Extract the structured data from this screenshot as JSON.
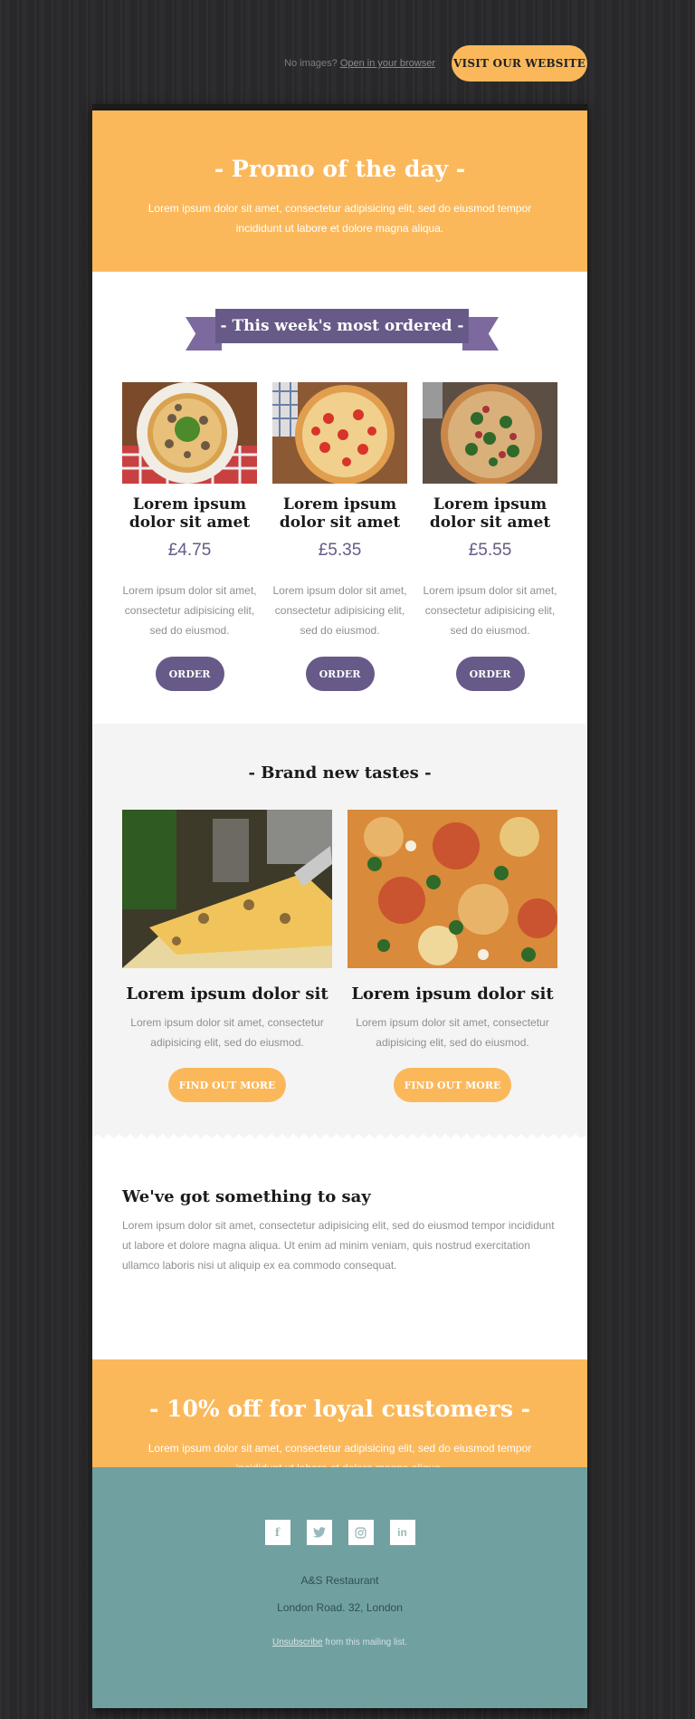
{
  "topbar": {
    "no_images_text": "No images?",
    "open_browser_link": "Open in your browser",
    "visit_button": "VISIT OUR WEBSITE"
  },
  "promo": {
    "title": "- Promo of the day -",
    "text": "Lorem ipsum dolor sit amet, consectetur adipisicing elit, sed do eiusmod tempor incididunt ut labore et dolore magna aliqua."
  },
  "most_ordered": {
    "title": "- This week's most ordered -",
    "items": [
      {
        "name": "Lorem ipsum dolor sit amet",
        "price": "£4.75",
        "text": "Lorem ipsum dolor sit amet, consectetur adipisicing elit, sed do eiusmod.",
        "button": "ORDER"
      },
      {
        "name": "Lorem ipsum dolor sit amet",
        "price": "£5.35",
        "text": "Lorem ipsum dolor sit amet, consectetur adipisicing elit, sed do eiusmod.",
        "button": "ORDER"
      },
      {
        "name": "Lorem ipsum dolor sit amet",
        "price": "£5.55",
        "text": "Lorem ipsum dolor sit amet, consectetur adipisicing elit, sed do eiusmod.",
        "button": "ORDER"
      }
    ]
  },
  "brand_new": {
    "title": "- Brand new tastes -",
    "items": [
      {
        "name": "Lorem ipsum dolor sit",
        "text": "Lorem ipsum dolor sit amet, consectetur adipisicing elit, sed do eiusmod.",
        "button": "FIND OUT MORE"
      },
      {
        "name": "Lorem ipsum dolor sit",
        "text": "Lorem ipsum dolor sit amet, consectetur adipisicing elit, sed do eiusmod.",
        "button": "FIND OUT MORE"
      }
    ]
  },
  "say": {
    "title": "We've got something to say",
    "text": "Lorem ipsum dolor sit amet, consectetur adipisicing elit, sed do eiusmod tempor incididunt ut labore et dolore magna aliqua. Ut enim ad minim veniam, quis nostrud exercitation ullamco laboris nisi ut aliquip ex ea commodo consequat."
  },
  "loyal": {
    "title": "- 10% off for loyal customers -",
    "text": "Lorem ipsum dolor sit amet, consectetur adipisicing elit, sed do eiusmod tempor incididunt ut labore et dolore magna aliqua."
  },
  "footer": {
    "socials": [
      {
        "icon": "facebook-icon",
        "glyph": "f"
      },
      {
        "icon": "twitter-icon",
        "glyph": "🐦"
      },
      {
        "icon": "instagram-icon",
        "glyph": "◎"
      },
      {
        "icon": "linkedin-icon",
        "glyph": "in"
      }
    ],
    "restaurant": "A&S Restaurant",
    "address": "London Road. 32, London",
    "unsubscribe_link": "Unsubscribe",
    "unsubscribe_rest": " from this mailing list."
  },
  "colors": {
    "accent_orange": "#fbb85b",
    "accent_purple": "#675a88",
    "footer_teal": "#71a0a1",
    "background_wood": "#2a2a2c"
  }
}
